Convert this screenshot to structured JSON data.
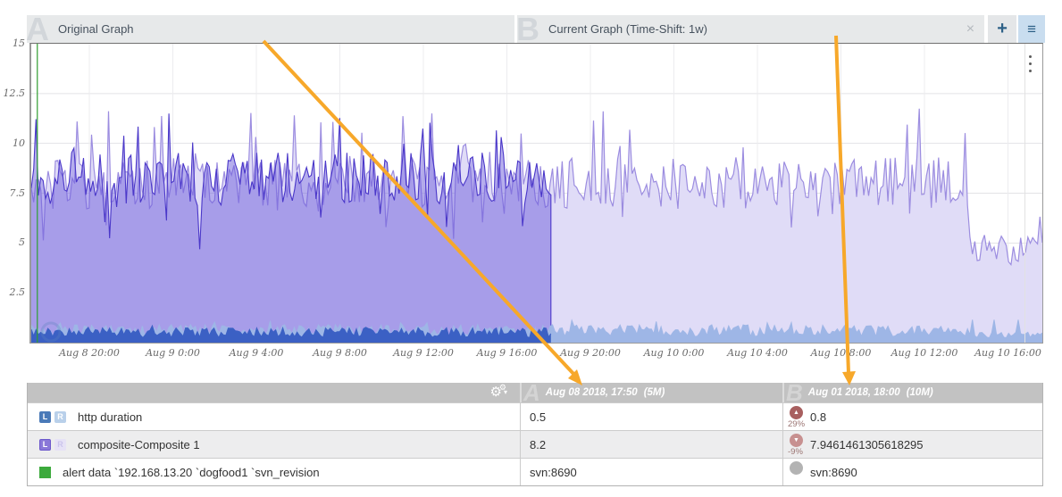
{
  "tabs": {
    "a": {
      "watermark": "A",
      "label": "Original Graph"
    },
    "b": {
      "watermark": "B",
      "label": "Current Graph (Time-Shift: 1w)"
    },
    "close_label": "×",
    "plus_label": "+",
    "menu_label": "≡"
  },
  "icons": {
    "gear": "⚙",
    "gear_small": "⚙",
    "caret": "▾",
    "up": "▲",
    "down": "▼",
    "kebab": "⋮"
  },
  "chart": {
    "y_ticks": [
      "15",
      "12.5",
      "10",
      "7.5",
      "5",
      "2.5"
    ],
    "x_ticks": [
      "Aug 8 20:00",
      "Aug 9 0:00",
      "Aug 9 4:00",
      "Aug 9 8:00",
      "Aug 9 12:00",
      "Aug 9 16:00",
      "Aug 9 20:00",
      "Aug 10 0:00",
      "Aug 10 4:00",
      "Aug 10 8:00",
      "Aug 10 12:00",
      "Aug 10 16:00"
    ]
  },
  "chart_data": {
    "type": "area",
    "ylim": [
      0,
      15
    ],
    "y_tick_values": [
      2.5,
      5,
      7.5,
      10,
      12.5,
      15
    ],
    "grid": true,
    "series": [
      {
        "name": "composite-Composite 1 (current, time-shifted 1w)",
        "kind": "area",
        "x_range": [
          0,
          1
        ],
        "mean": 8.0,
        "noise": 1.3,
        "spike_chance": 0.09,
        "spike_max": 11.8,
        "dip_chance": 0.07,
        "dip_depth": 2.2,
        "drop_after": 0.927,
        "drop_mean": 4.6,
        "drop_noise": 0.8,
        "points": 420,
        "seed": 7,
        "line": "#9c8de0",
        "fill": "#e0dcf7",
        "line_width": 1.2
      },
      {
        "name": "composite-Composite 1 (original)",
        "kind": "area",
        "x_range": [
          0,
          0.514
        ],
        "mean": 8.2,
        "noise": 1.35,
        "spike_chance": 0.09,
        "spike_max": 11.6,
        "dip_chance": 0.07,
        "dip_depth": 2.4,
        "points": 220,
        "seed": 13,
        "line": "#4a37c9",
        "fill": "rgba(110,94,220,0.5)",
        "line_width": 1.1,
        "close_edge": true
      },
      {
        "name": "http duration (current, time-shifted 1w)",
        "kind": "area",
        "x_range": [
          0,
          1
        ],
        "mean": 0.6,
        "noise": 0.3,
        "spike_chance": 0.05,
        "spike_max": 1.15,
        "drop_after": 0.927,
        "drop_mean": 0.38,
        "drop_noise": 0.15,
        "points": 420,
        "seed": 21,
        "line": "#9eb6e6",
        "fill": "#9eb6e6",
        "line_width": 1
      },
      {
        "name": "http duration (original)",
        "kind": "area",
        "x_range": [
          0,
          0.514
        ],
        "mean": 0.5,
        "noise": 0.25,
        "spike_chance": 0.05,
        "spike_max": 1.0,
        "points": 220,
        "seed": 5,
        "line": "#3b60c4",
        "fill": "#3b60c4",
        "line_width": 1
      },
      {
        "name": "alert data svn_revision change",
        "kind": "vline",
        "x": 0.006,
        "color": "#2f9e2f"
      }
    ]
  },
  "table": {
    "header": {
      "a_watermark": "A",
      "a_date": "Aug 08 2018, 17:50",
      "a_window": "(5M)",
      "b_watermark": "B",
      "b_date": "Aug 01 2018, 18:00",
      "b_window": "(10M)"
    },
    "rows": [
      {
        "label": "http duration",
        "axis_left": "L",
        "axis_right": "R",
        "a_value": "0.5",
        "b_value": "0.8",
        "delta": "29%",
        "trend": "up"
      },
      {
        "label": "composite-Composite 1",
        "axis_left": "L",
        "axis_right": "R",
        "a_value": "8.2",
        "b_value": "7.9461461305618295",
        "delta": "-9%",
        "trend": "down"
      },
      {
        "label": "alert data `192.168.13.20 `dogfood1 `svn_revision",
        "a_value": "svn:8690",
        "b_value": "svn:8690",
        "delta": "",
        "trend": "flat"
      }
    ]
  },
  "colors": {
    "accent_arrow": "#f7a82a",
    "tab_bg": "#e7e9ea",
    "menu_btn_bg": "#c9ddef",
    "btn_glyph": "#2e6187",
    "header_bg": "#c2c2c2",
    "badge_up": "#a85f5f",
    "badge_down": "#c79090",
    "badge_flat": "#b3b3b3",
    "alert_green": "#3caa3c"
  }
}
